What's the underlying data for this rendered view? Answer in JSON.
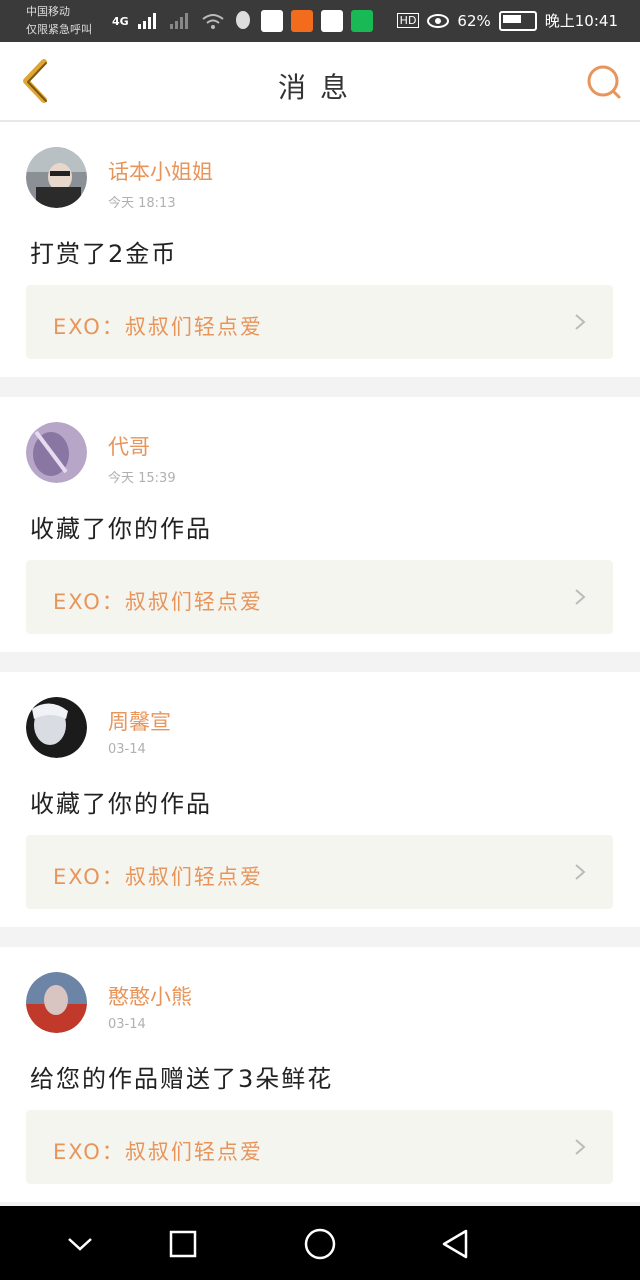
{
  "status_bar": {
    "carrier_line1": "中国移动",
    "carrier_line2": "仅限紧急呼叫",
    "network": "4G",
    "hd": "HD",
    "battery": "62%",
    "time": "晚上10:41"
  },
  "header": {
    "title": "消息"
  },
  "messages": [
    {
      "username": "话本小姐姐",
      "time": "今天 18:13",
      "action": "打赏了2金币",
      "work": "EXO：叔叔们轻点爱"
    },
    {
      "username": "代哥",
      "time": "今天 15:39",
      "action": "收藏了你的作品",
      "work": "EXO：叔叔们轻点爱"
    },
    {
      "username": "周馨宣",
      "time": "03-14",
      "action": "收藏了你的作品",
      "work": "EXO：叔叔们轻点爱"
    },
    {
      "username": "憨憨小熊",
      "time": "03-14",
      "action": "给您的作品赠送了3朵鲜花",
      "work": "EXO：叔叔们轻点爱"
    }
  ],
  "colors": {
    "accent": "#e8955b",
    "back_arrow": "#e0a534",
    "card_link_bg": "#f5f5ef"
  }
}
